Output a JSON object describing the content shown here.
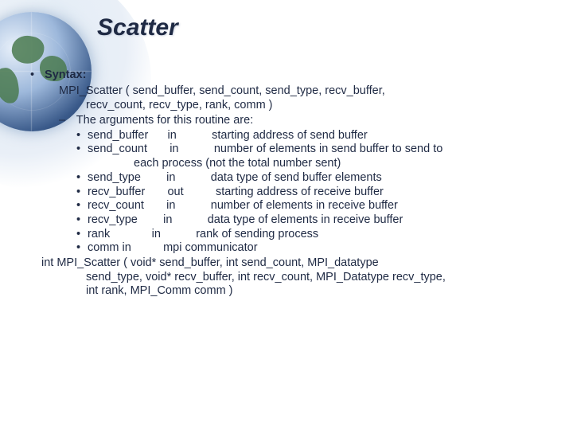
{
  "title": "Scatter",
  "syntax_label": "Syntax:",
  "call_sig_line1": "MPI_Scatter ( send_buffer, send_count, send_type, recv_buffer,",
  "call_sig_line2": "recv_count, recv_type, rank, comm )",
  "args_intro": "The arguments for this routine are:",
  "args": [
    {
      "name": "send_buffer",
      "dir": "in",
      "desc": "starting address of send buffer"
    },
    {
      "name": "send_count",
      "dir": "in",
      "desc": "number of elements in send buffer to send to"
    }
  ],
  "arg2_cont": "each process (not the total number sent)",
  "args_rest": [
    {
      "name": "send_type",
      "dir": "in",
      "desc": "data type of send buffer elements"
    },
    {
      "name": "recv_buffer",
      "dir": "out",
      "desc": "starting address of receive buffer"
    },
    {
      "name": "recv_count",
      "dir": "in",
      "desc": "number of elements in receive buffer"
    },
    {
      "name": "recv_type",
      "dir": "in",
      "desc": "data type of elements in receive buffer"
    },
    {
      "name": "rank",
      "dir": "in",
      "desc": "rank of sending process"
    }
  ],
  "arg_comm": {
    "text": "comm in",
    "desc": "mpi communicator"
  },
  "proto_line1": "int MPI_Scatter ( void* send_buffer, int send_count, MPI_datatype",
  "proto_line2": "send_type, void* recv_buffer, int recv_count, MPI_Datatype recv_type,",
  "proto_line3": "int rank, MPI_Comm comm )"
}
